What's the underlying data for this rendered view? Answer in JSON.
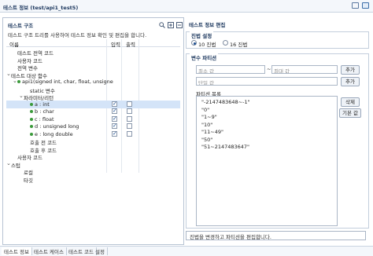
{
  "window": {
    "title": "테스트 정보 (test/api1_test5)"
  },
  "tree": {
    "section_title": "테스트 구조",
    "description": "테스트 구조 트리를 사용하여 테스트 정보 확인 및 편집을 합니다.",
    "columns": {
      "name": "이름",
      "input": "입력",
      "output": "출력"
    },
    "rows": [
      {
        "label": "테스트 전역 코드",
        "indent": 1,
        "arrow": "",
        "dot": false,
        "cb": false
      },
      {
        "label": "사용자 코드",
        "indent": 1,
        "arrow": "",
        "dot": false,
        "cb": false
      },
      {
        "label": "전역 변수",
        "indent": 1,
        "arrow": "",
        "dot": false,
        "cb": false
      },
      {
        "label": "테스트 대상 함수",
        "indent": 0,
        "arrow": "v",
        "dot": false,
        "cb": false
      },
      {
        "label": "api1(signed int, char, float, unsigne",
        "indent": 1,
        "arrow": "v",
        "dot": true,
        "cb": false
      },
      {
        "label": "static 변수",
        "indent": 3,
        "arrow": "",
        "dot": false,
        "cb": false
      },
      {
        "label": "파라미터/리턴",
        "indent": 2,
        "arrow": "v",
        "dot": false,
        "cb": false
      },
      {
        "label": "a  :  int",
        "indent": 3,
        "arrow": "",
        "dot": true,
        "cb": true,
        "in": true,
        "out": false,
        "sel": true
      },
      {
        "label": "b  :  char",
        "indent": 3,
        "arrow": "",
        "dot": true,
        "cb": true,
        "in": true,
        "out": false
      },
      {
        "label": "c  :  float",
        "indent": 3,
        "arrow": "",
        "dot": true,
        "cb": true,
        "in": true,
        "out": false
      },
      {
        "label": "d  :  unsigned long",
        "indent": 3,
        "arrow": "",
        "dot": true,
        "cb": true,
        "in": true,
        "out": false
      },
      {
        "label": "e  :  long double",
        "indent": 3,
        "arrow": "",
        "dot": true,
        "cb": true,
        "in": true,
        "out": false
      },
      {
        "label": "호출 전 코드",
        "indent": 3,
        "arrow": "",
        "dot": false,
        "cb": false
      },
      {
        "label": "호출 후 코드",
        "indent": 3,
        "arrow": "",
        "dot": false,
        "cb": false
      },
      {
        "label": "사용자 코드",
        "indent": 1,
        "arrow": "",
        "dot": false,
        "cb": false
      },
      {
        "label": "스텁",
        "indent": 0,
        "arrow": "v",
        "dot": false,
        "cb": false
      },
      {
        "label": "로컬",
        "indent": 2,
        "arrow": "",
        "dot": false,
        "cb": false
      },
      {
        "label": "타깃",
        "indent": 2,
        "arrow": "",
        "dot": false,
        "cb": false
      }
    ]
  },
  "editor": {
    "section_title": "테스트 정보 편집",
    "radix": {
      "title": "진법 설정",
      "options": [
        "10 진법",
        "16 진법"
      ],
      "selected": 0
    },
    "params": {
      "title": "변수 파티션",
      "min_placeholder": "최소 값",
      "tilde": "~",
      "max_placeholder": "최대 값",
      "single_placeholder": "단일 값",
      "add_label": "추가",
      "list_title": "파티션 목록",
      "partitions": [
        "\"-2147483648~-1\"",
        "\"0\"",
        "\"1~9\"",
        "\"10\"",
        "\"11~49\"",
        "\"50\"",
        "\"51~2147483647\""
      ],
      "delete_label": "삭제",
      "default_label": "기본 값"
    },
    "status_text": "진법을 변경하고 파티션을 편집합니다."
  },
  "tabs": [
    "테스트 정보",
    "테스트 케이스",
    "테스트 코드",
    "설정"
  ],
  "active_tab": 0,
  "colors": {
    "accent": "#1d4f91",
    "selected_row": "#d4e4f8",
    "tree_dot": "#3b9a3b"
  }
}
